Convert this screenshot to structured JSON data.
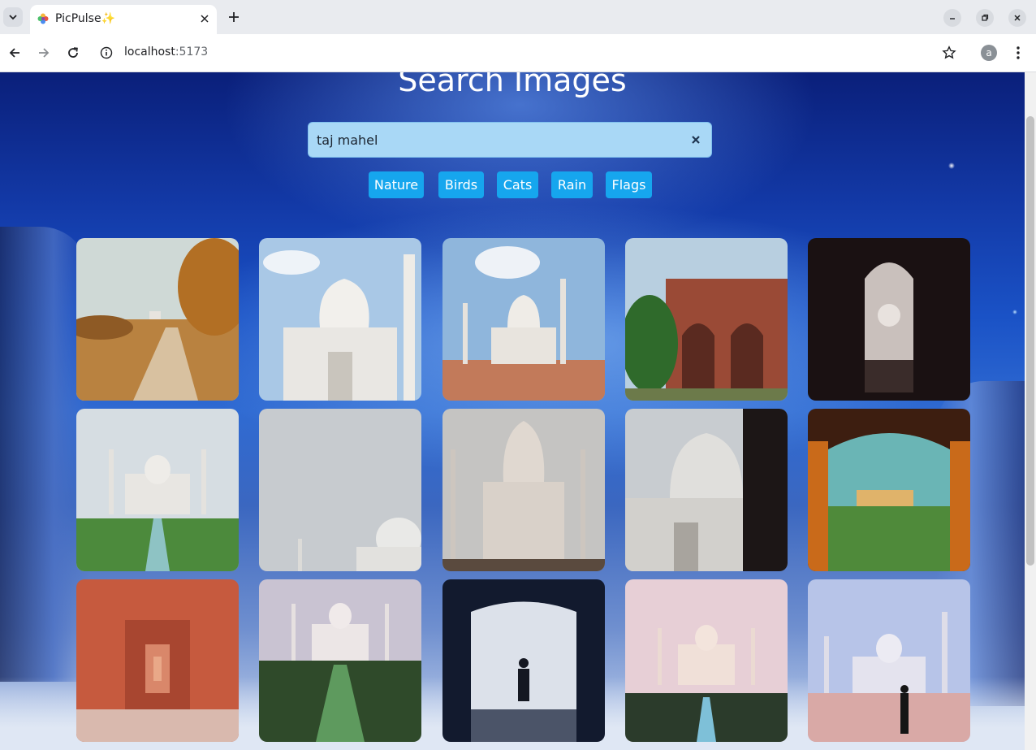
{
  "browser": {
    "tab_title": "PicPulse✨",
    "url_host": "localhost",
    "url_port": ":5173",
    "profile_initial": "a"
  },
  "page": {
    "heading": "Search Images",
    "search": {
      "value": "taj mahel"
    },
    "chips": [
      {
        "label": "Nature"
      },
      {
        "label": "Birds"
      },
      {
        "label": "Cats"
      },
      {
        "label": "Rain"
      },
      {
        "label": "Flags"
      }
    ]
  },
  "images": [
    {
      "subject": "path-through-autumn-trees-to-taj-mahal"
    },
    {
      "subject": "taj-mahal-close-up-with-minaret"
    },
    {
      "subject": "taj-mahal-courtyard-wide"
    },
    {
      "subject": "red-sandstone-gateway"
    },
    {
      "subject": "taj-mahal-through-dark-arch"
    },
    {
      "subject": "taj-mahal-with-reflecting-pool"
    },
    {
      "subject": "taj-mahal-in-haze-corner"
    },
    {
      "subject": "taj-mahal-foggy-front"
    },
    {
      "subject": "taj-mahal-dome-side-view"
    },
    {
      "subject": "taj-mahal-through-ornate-arch"
    },
    {
      "subject": "red-sandstone-corridor"
    },
    {
      "subject": "taj-mahal-pool-at-dawn"
    },
    {
      "subject": "silhouette-in-archway"
    },
    {
      "subject": "taj-mahal-at-sunrise"
    },
    {
      "subject": "person-walking-to-taj-mahal"
    }
  ],
  "colors": {
    "chip_bg": "#16a6ee",
    "search_bg": "#a9d8f6"
  }
}
